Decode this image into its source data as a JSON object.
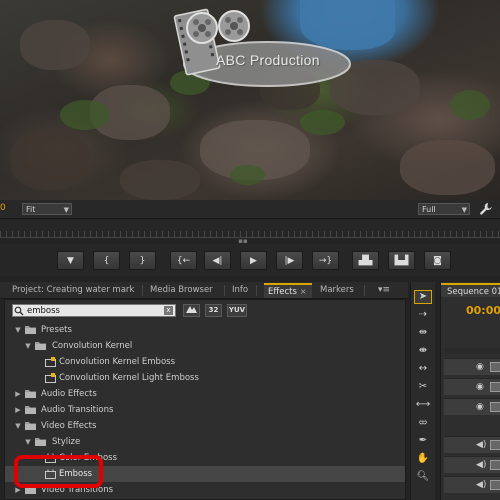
{
  "preview": {
    "watermark_text": "ABC Production"
  },
  "monitor": {
    "timecode_left": "0",
    "zoom_select": "Fit",
    "quality_select": "Full"
  },
  "transport": {
    "buttons": [
      {
        "icon": "marker-icon",
        "glyph": "▼"
      },
      {
        "icon": "mark-in-icon",
        "glyph": "{"
      },
      {
        "icon": "mark-out-icon",
        "glyph": "}"
      },
      {
        "icon": "go-to-in-icon",
        "glyph": "{←"
      },
      {
        "icon": "step-back-icon",
        "glyph": "◀|"
      },
      {
        "icon": "play-icon",
        "glyph": "▶"
      },
      {
        "icon": "step-forward-icon",
        "glyph": "|▶"
      },
      {
        "icon": "go-to-out-icon",
        "glyph": "→}"
      },
      {
        "icon": "lift-icon",
        "glyph": "▟▙"
      },
      {
        "icon": "extract-icon",
        "glyph": "▙▟"
      },
      {
        "icon": "export-frame-icon",
        "glyph": "◙"
      }
    ]
  },
  "tabs": {
    "project": "Project: Creating water mark",
    "media_browser": "Media Browser",
    "info": "Info",
    "effects": "Effects",
    "markers": "Markers",
    "close_glyph": "×",
    "menu_glyph": "▾≡"
  },
  "effects": {
    "search_value": "emboss",
    "filter_buttons": [
      "",
      "32",
      "YUV"
    ],
    "tree": [
      {
        "label": "Presets",
        "level": 0,
        "type": "folder",
        "twisty": "open"
      },
      {
        "label": "Convolution Kernel",
        "level": 1,
        "type": "folder",
        "twisty": "open"
      },
      {
        "label": "Convolution Kernel Emboss",
        "level": 2,
        "type": "preset"
      },
      {
        "label": "Convolution Kernel Light Emboss",
        "level": 2,
        "type": "preset"
      },
      {
        "label": "Audio Effects",
        "level": 0,
        "type": "folder",
        "twisty": "closed"
      },
      {
        "label": "Audio Transitions",
        "level": 0,
        "type": "folder",
        "twisty": "closed"
      },
      {
        "label": "Video Effects",
        "level": 0,
        "type": "folder",
        "twisty": "open"
      },
      {
        "label": "Stylize",
        "level": 1,
        "type": "folder",
        "twisty": "open"
      },
      {
        "label": "Color Emboss",
        "level": 2,
        "type": "effect"
      },
      {
        "label": "Emboss",
        "level": 2,
        "type": "effect",
        "selected": true
      },
      {
        "label": "Video Transitions",
        "level": 0,
        "type": "folder",
        "twisty": "closed"
      }
    ]
  },
  "tools": [
    "selection-tool-icon",
    "track-select-tool-icon",
    "ripple-edit-tool-icon",
    "rolling-edit-tool-icon",
    "rate-stretch-tool-icon",
    "razor-tool-icon",
    "slip-tool-icon",
    "slide-tool-icon",
    "pen-tool-icon",
    "hand-tool-icon",
    "zoom-tool-icon"
  ],
  "sequence": {
    "tab_label": "Sequence 01",
    "timecode": "00:00"
  },
  "colors": {
    "accent": "#d9a600",
    "timecode": "#e0a000",
    "highlight": "#e00000"
  }
}
